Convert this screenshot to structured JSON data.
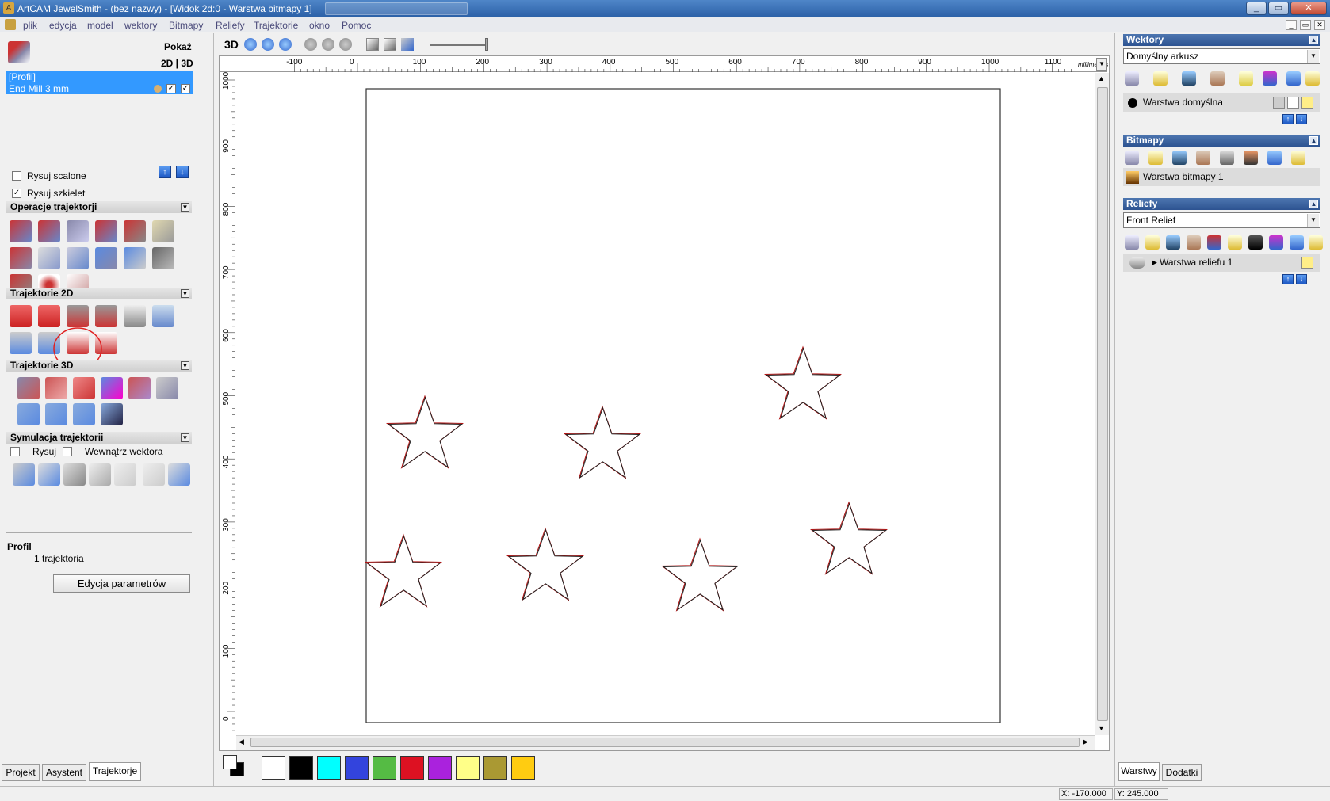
{
  "window": {
    "title": "ArtCAM JewelSmith - (bez nazwy) - [Widok 2d:0 - Warstwa bitmapy 1]"
  },
  "menu": [
    "plik",
    "edycja",
    "model",
    "wektory",
    "Bitmapy",
    "Reliefy",
    "Trajektorie",
    "okno",
    "Pomoc"
  ],
  "left": {
    "show_label": "Pokaż",
    "mode_label": "2D | 3D",
    "toolpath_list": [
      {
        "label": "[Profil]"
      },
      {
        "label": "End Mill 3 mm"
      }
    ],
    "draw_merged": "Rysuj scalone",
    "draw_skeleton": "Rysuj szkielet",
    "sections": {
      "ops": "Operacje trajektorji",
      "t2d": "Trajektorie 2D",
      "t3d": "Trajektorie 3D",
      "sim": "Symulacja trajektorii"
    },
    "sim_draw": "Rysuj",
    "sim_inside": "Wewnątrz wektora",
    "summary_title": "Profil",
    "summary_count": "1 trajektoria",
    "edit_button": "Edycja parametrów",
    "tabs": [
      "Projekt",
      "Asystent",
      "Trajektorje"
    ]
  },
  "view": {
    "mode_3d": "3D",
    "units": "millimetres",
    "hruler": [
      "-100",
      "0",
      "100",
      "200",
      "300",
      "400",
      "500",
      "600",
      "700",
      "800",
      "900",
      "1000",
      "1100"
    ],
    "vruler": [
      "1000",
      "900",
      "800",
      "700",
      "600",
      "500",
      "400",
      "300",
      "200",
      "100",
      "0"
    ]
  },
  "palette": {
    "colors": [
      "#ffffff",
      "#000000",
      "#00ffff",
      "#3344dd",
      "#55bb44",
      "#dd1122",
      "#aa22dd",
      "#ffff88",
      "#aa9933",
      "#ffcc11"
    ]
  },
  "right": {
    "vectors": {
      "title": "Wektory",
      "sheet": "Domyślny arkusz",
      "layer": "Warstwa domyślna"
    },
    "bitmaps": {
      "title": "Bitmapy",
      "layer": "Warstwa bitmapy 1"
    },
    "reliefs": {
      "title": "Reliefy",
      "relief": "Front Relief",
      "layer": "Warstwa reliefu 1"
    },
    "tabs": [
      "Warstwy",
      "Dodatki"
    ]
  },
  "status": {
    "x": "X: -170.000",
    "y": "Y: 245.000"
  }
}
